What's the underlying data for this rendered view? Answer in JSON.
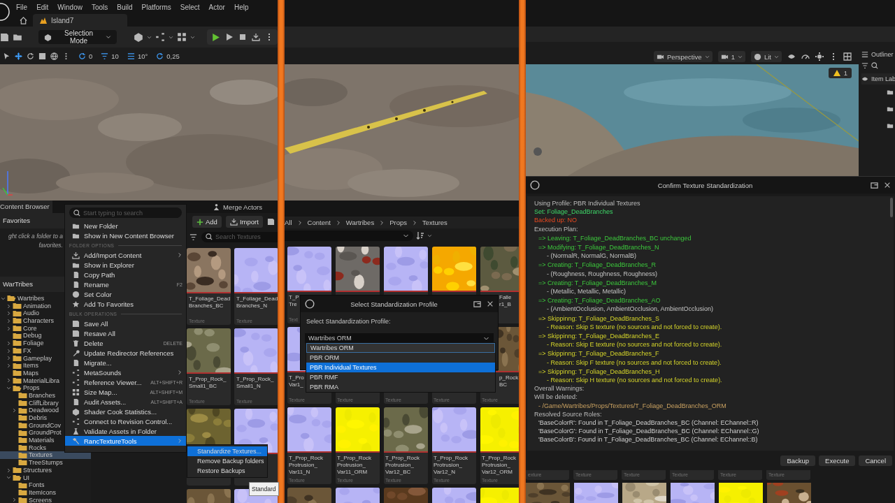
{
  "menu_bar": [
    "File",
    "Edit",
    "Window",
    "Tools",
    "Build",
    "Platforms",
    "Select",
    "Actor",
    "Help"
  ],
  "level_tab": {
    "label": "Island7"
  },
  "mode_button": {
    "label": "Selection Mode"
  },
  "snap_fields": [
    {
      "value": "0"
    },
    {
      "value": "10"
    },
    {
      "value": "10°"
    },
    {
      "value": "0,25"
    }
  ],
  "content_browser": {
    "tab": "Content Browser",
    "merge_actors": "Merge Actors",
    "add_button": "Add",
    "import_button": "Import",
    "search": {
      "placeholder": "Search Textures"
    },
    "favorites": {
      "title": "Favorites",
      "hint": [
        "ght click a folder to a",
        "favorites."
      ]
    },
    "project": "WarTribes",
    "tree": [
      {
        "label": "Wartribes",
        "expandable": true,
        "expanded": true,
        "selected": false,
        "children": [
          {
            "label": "Animation",
            "expandable": true,
            "expanded": false,
            "selected": false
          },
          {
            "label": "Audio",
            "expandable": true,
            "expanded": false,
            "selected": false
          },
          {
            "label": "Characters",
            "expandable": true,
            "expanded": false,
            "selected": false
          },
          {
            "label": "Core",
            "expandable": true,
            "expanded": false,
            "selected": false
          },
          {
            "label": "Debug",
            "expandable": false,
            "expanded": false,
            "selected": false
          },
          {
            "label": "Foliage",
            "expandable": true,
            "expanded": false,
            "selected": false
          },
          {
            "label": "FX",
            "expandable": true,
            "expanded": false,
            "selected": false
          },
          {
            "label": "Gameplay",
            "expandable": true,
            "expanded": false,
            "selected": false
          },
          {
            "label": "Items",
            "expandable": true,
            "expanded": false,
            "selected": false
          },
          {
            "label": "Maps",
            "expandable": false,
            "expanded": false,
            "selected": false
          },
          {
            "label": "MaterialLibra",
            "expandable": true,
            "expanded": false,
            "selected": false
          },
          {
            "label": "Props",
            "expandable": true,
            "expanded": true,
            "selected": false,
            "children": [
              {
                "label": "Branches",
                "expandable": false,
                "expanded": false,
                "selected": false
              },
              {
                "label": "CliffLibrary",
                "expandable": false,
                "expanded": false,
                "selected": false
              },
              {
                "label": "Deadwood",
                "expandable": true,
                "expanded": false,
                "selected": false
              },
              {
                "label": "Debris",
                "expandable": false,
                "expanded": false,
                "selected": false
              },
              {
                "label": "GroundCov",
                "expandable": false,
                "expanded": false,
                "selected": false
              },
              {
                "label": "GroundProt",
                "expandable": false,
                "expanded": false,
                "selected": false
              },
              {
                "label": "Materials",
                "expandable": false,
                "expanded": false,
                "selected": false
              },
              {
                "label": "Rocks",
                "expandable": false,
                "expanded": false,
                "selected": false
              },
              {
                "label": "Textures",
                "expandable": false,
                "expanded": false,
                "selected": true
              },
              {
                "label": "TreeStumps",
                "expandable": false,
                "expanded": false,
                "selected": false
              }
            ]
          },
          {
            "label": "Structures",
            "expandable": true,
            "expanded": false,
            "selected": false
          },
          {
            "label": "UI",
            "expandable": true,
            "expanded": true,
            "selected": false,
            "children": [
              {
                "label": "Fonts",
                "expandable": false,
                "expanded": false,
                "selected": false
              },
              {
                "label": "ItemIcons",
                "expandable": false,
                "expanded": false,
                "selected": false
              },
              {
                "label": "Screens",
                "expandable": true,
                "expanded": false,
                "selected": false
              }
            ]
          }
        ]
      }
    ],
    "tiles": [
      {
        "kind": "picture",
        "label": [
          "T_Foliage_Dead",
          "Branches_BC"
        ],
        "asset_type": "Texture"
      },
      {
        "kind": "picture",
        "label": [
          "T_Foliage_Dead",
          "Branches_N"
        ],
        "asset_type": "Texture"
      },
      {
        "kind": "picture",
        "label": [
          "T_Prop_Rock_",
          "Small1_BC"
        ],
        "asset_type": "Texture"
      },
      {
        "kind": "picture",
        "label": [
          "T_Prop_Rock_",
          "Small1_N"
        ],
        "asset_type": "Texture"
      },
      {
        "kind": "picture"
      },
      {
        "kind": "picture"
      },
      {
        "kind": "picture"
      },
      {
        "kind": "picture"
      }
    ]
  },
  "context_menu": {
    "search": {
      "placeholder": "Start typing to search"
    },
    "entries": [
      {
        "kind": "item",
        "label": "New Folder",
        "selected": false
      },
      {
        "kind": "item",
        "label": "Show in New Content Browser",
        "selected": false
      },
      {
        "kind": "header",
        "label": "FOLDER OPTIONS"
      },
      {
        "kind": "item",
        "label": "Add/Import Content",
        "has_submenu": true,
        "selected": false
      },
      {
        "kind": "item",
        "label": "Show in Explorer",
        "selected": false
      },
      {
        "kind": "item",
        "label": "Copy Path",
        "selected": false
      },
      {
        "kind": "item",
        "label": "Rename",
        "shortcut": "F2",
        "selected": false
      },
      {
        "kind": "item",
        "label": "Set Color",
        "selected": false
      },
      {
        "kind": "item",
        "label": "Add To Favorites",
        "selected": false
      },
      {
        "kind": "header",
        "label": "BULK OPERATIONS"
      },
      {
        "kind": "item",
        "label": "Save All",
        "selected": false
      },
      {
        "kind": "item",
        "label": "Resave All",
        "selected": false
      },
      {
        "kind": "item",
        "label": "Delete",
        "shortcut": "DELETE",
        "selected": false
      },
      {
        "kind": "item",
        "label": "Update Redirector References",
        "selected": false
      },
      {
        "kind": "item",
        "label": "Migrate...",
        "selected": false
      },
      {
        "kind": "item",
        "label": "MetaSounds",
        "has_submenu": true,
        "selected": false
      },
      {
        "kind": "item",
        "label": "Reference Viewer...",
        "shortcut": "ALT+SHIFT+R",
        "selected": false
      },
      {
        "kind": "item",
        "label": "Size Map...",
        "shortcut": "ALT+SHIFT+M",
        "selected": false
      },
      {
        "kind": "item",
        "label": "Audit Assets...",
        "shortcut": "ALT+SHIFT+A",
        "selected": false
      },
      {
        "kind": "item",
        "label": "Shader Cook Statistics...",
        "selected": false
      },
      {
        "kind": "item",
        "label": "Connect to Revision Control...",
        "selected": false
      },
      {
        "kind": "item",
        "label": "Validate Assets in Folder",
        "selected": false
      },
      {
        "kind": "item",
        "label": "RancTextureTools",
        "has_submenu": true,
        "selected": true
      }
    ]
  },
  "submenu": {
    "items": [
      {
        "label": "Standardize Textures...",
        "selected": true
      },
      {
        "label": "Remove Backup folders",
        "selected": false
      },
      {
        "label": "Restore Backups",
        "selected": false
      }
    ]
  },
  "tooltip": "Standard",
  "browser_2": {
    "breadcrumbs": [
      "All",
      "Content",
      "Wartribes",
      "Props",
      "Textures"
    ],
    "tiles": [
      {
        "kind": "picture",
        "label": [
          "T_P",
          "Tre"
        ],
        "asset_type": "Text"
      },
      {
        "kind": "picture"
      },
      {
        "kind": "picture"
      },
      {
        "kind": "picture"
      },
      {
        "kind": "picture",
        "label": [
          "Falle",
          "r1_B"
        ],
        "cut_left": true
      },
      {
        "kind": "picture",
        "label": [
          "T_Pro",
          "Var1_"
        ],
        "asset_type": "Texture"
      },
      {
        "asset_type": "Texture"
      },
      {
        "asset_type": "Texture"
      },
      {
        "asset_type": "Texture"
      },
      {
        "kind": "picture",
        "label": [
          "p_Rock",
          "BC"
        ],
        "cut_left": true,
        "asset_type": "Texture"
      },
      {
        "kind": "picture",
        "label": [
          "T_Prop_Rock",
          "Protrusion_",
          "Var11_N"
        ],
        "asset_type": "Texture"
      },
      {
        "kind": "picture",
        "label": [
          "T_Prop_Rock",
          "Protrusion_",
          "Var11_ORM"
        ],
        "asset_type": "Texture"
      },
      {
        "kind": "picture",
        "label": [
          "T_Prop_Rock",
          "Protrusion_",
          "Var12_BC"
        ],
        "asset_type": "Texture"
      },
      {
        "kind": "picture",
        "label": [
          "T_Prop_Rock",
          "Protrusion_",
          "Var12_N"
        ],
        "asset_type": "Texture"
      },
      {
        "kind": "picture",
        "label": [
          "T_Prop_Rock",
          "Protrusion_",
          "Var12_ORM"
        ],
        "asset_type": "Texture"
      },
      {
        "kind": "picture"
      },
      {
        "kind": "picture"
      },
      {
        "kind": "picture"
      },
      {
        "kind": "picture"
      },
      {
        "kind": "picture"
      }
    ]
  },
  "profile_dialog": {
    "title": "Select Standardization Profile",
    "prompt": "Select Standardization Profile:",
    "combo": {
      "value": "Wartribes ORM"
    },
    "options": [
      {
        "label": "Wartribes ORM",
        "selected": false,
        "focused": true
      },
      {
        "label": "PBR ORM",
        "selected": false,
        "focused": false
      },
      {
        "label": "PBR Individual Textures",
        "selected": true,
        "focused": false
      },
      {
        "label": "PBR RMF",
        "selected": false,
        "focused": false
      },
      {
        "label": "PBR RMA",
        "selected": false,
        "focused": false
      }
    ]
  },
  "viewport_toolbar": {
    "view": "Perspective",
    "camera_speed": "1",
    "mode": "Lit"
  },
  "warning_badge": "1",
  "outliner": {
    "title": "Outliner",
    "column": "Item Lab"
  },
  "confirm_dialog": {
    "title": "Confirm Texture Standardization",
    "lines": [
      {
        "kind": "info",
        "text": "Using Profile: PBR Individual Textures"
      },
      {
        "kind": "set",
        "text": "Set: Foliage_DeadBranches"
      },
      {
        "kind": "alert",
        "text": "Backed up: NO"
      },
      {
        "kind": "info",
        "text": "Execution Plan:"
      },
      {
        "kind": "ok",
        "text": "=> Leaving: T_Foliage_DeadBranches_BC unchanged"
      },
      {
        "kind": "ok",
        "text": "=> Modifying: T_Foliage_DeadBranches_N"
      },
      {
        "kind": "detail",
        "text": "- (NormalR, NormalG, NormalB)"
      },
      {
        "kind": "ok",
        "text": "=> Creating: T_Foliage_DeadBranches_R"
      },
      {
        "kind": "detail",
        "text": "- (Roughness, Roughness, Roughness)"
      },
      {
        "kind": "ok",
        "text": "=> Creating: T_Foliage_DeadBranches_M"
      },
      {
        "kind": "detail",
        "text": "- (Metallic, Metallic, Metallic)"
      },
      {
        "kind": "ok",
        "text": "=> Creating: T_Foliage_DeadBranches_AO"
      },
      {
        "kind": "detail",
        "text": "- (AmbientOcclusion, AmbientOcclusion, AmbientOcclusion)"
      },
      {
        "kind": "skip",
        "text": "=> Skippinng: T_Foliage_DeadBranches_S"
      },
      {
        "kind": "reason",
        "text": "- Reason: Skip S texture (no sources and not forced to create)."
      },
      {
        "kind": "skip",
        "text": "=> Skippinng: T_Foliage_DeadBranches_E"
      },
      {
        "kind": "reason",
        "text": "- Reason: Skip E texture (no sources and not forced to create)."
      },
      {
        "kind": "skip",
        "text": "=> Skippinng: T_Foliage_DeadBranches_F"
      },
      {
        "kind": "reason",
        "text": "- Reason: Skip F texture (no sources and not forced to create)."
      },
      {
        "kind": "skip",
        "text": "=> Skippinng: T_Foliage_DeadBranches_H"
      },
      {
        "kind": "reason",
        "text": "- Reason: Skip H texture (no sources and not forced to create)."
      },
      {
        "kind": "info",
        "text": "Overall Warnings:"
      },
      {
        "kind": "info",
        "text": "Will be deleted:"
      },
      {
        "kind": "path",
        "text": "- /Game/Wartribes/Props/Textures/T_Foliage_DeadBranches_ORM"
      },
      {
        "kind": "info",
        "text": "Resolved Source Roles:"
      },
      {
        "kind": "source",
        "text": "'BaseColorR': Found in T_Foliage_DeadBranches_BC (Channel: EChannel::R)"
      },
      {
        "kind": "source",
        "text": "'BaseColorG': Found in T_Foliage_DeadBranches_BC (Channel: EChannel::G)"
      },
      {
        "kind": "source",
        "text": "'BaseColorB': Found in T_Foliage_DeadBranches_BC (Channel: EChannel::B)"
      }
    ],
    "buttons": [
      "Backup",
      "Execute",
      "Cancel"
    ]
  },
  "browser_3": {
    "tiles": [
      {
        "kind": "picture",
        "asset_type": "exture"
      },
      {
        "kind": "picture",
        "asset_type": "Texture"
      },
      {
        "kind": "picture",
        "asset_type": "Texture"
      },
      {
        "kind": "picture",
        "asset_type": "Texture"
      },
      {
        "kind": "picture",
        "asset_type": "Texture"
      },
      {
        "kind": "picture",
        "asset_type": "Texture"
      }
    ]
  }
}
